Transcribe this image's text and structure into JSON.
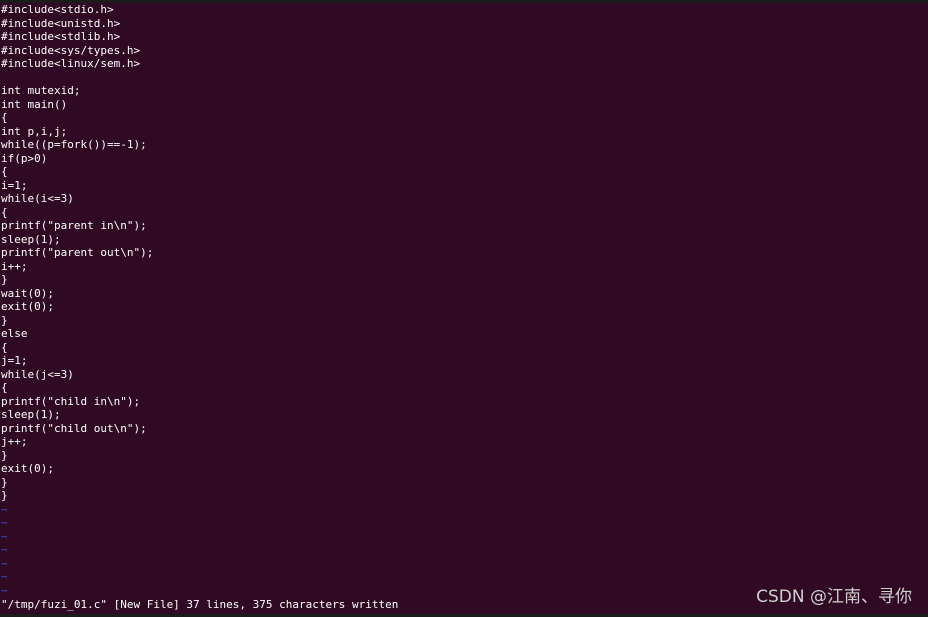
{
  "editor": {
    "lines": [
      "#include<stdio.h>",
      "#include<unistd.h>",
      "#include<stdlib.h>",
      "#include<sys/types.h>",
      "#include<linux/sem.h>",
      "",
      "int mutexid;",
      "int main()",
      "{",
      "int p,i,j;",
      "while((p=fork())==-1);",
      "if(p>0)",
      "{",
      "i=1;",
      "while(i<=3)",
      "{",
      "printf(\"parent in\\n\");",
      "sleep(1);",
      "printf(\"parent out\\n\");",
      "i++;",
      "}",
      "wait(0);",
      "exit(0);",
      "}",
      "else",
      "{",
      "j=1;",
      "while(j<=3)",
      "{",
      "printf(\"child in\\n\");",
      "sleep(1);",
      "printf(\"child out\\n\");",
      "j++;",
      "}",
      "exit(0);",
      "}",
      "}"
    ],
    "empty_line_marker": "~",
    "empty_line_count": 7
  },
  "status": {
    "message": "\"/tmp/fuzi_01.c\" [New File] 37 lines, 375 characters written"
  },
  "watermark": {
    "text": "CSDN @江南、寻你"
  },
  "colors": {
    "background": "#300a24",
    "text": "#ffffff",
    "tilde": "#4a4ad8",
    "watermark": "#cfcfcf"
  }
}
